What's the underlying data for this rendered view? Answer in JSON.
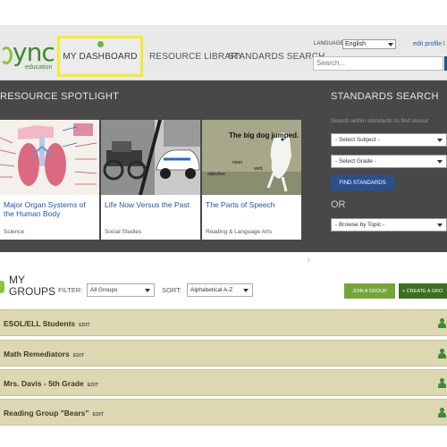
{
  "header": {
    "logo_text": "ync",
    "logo_sub": "education",
    "nav": {
      "dashboard": "MY DASHBOARD",
      "resource_library": "RESOURCE LIBRARY",
      "standards_search": "STANDARDS SEARCH"
    },
    "language_label": "LANGUAGE:",
    "language_value": "English",
    "edit_profile": "edit profile",
    "edit_profile_trail": "l",
    "search_placeholder": "Search..."
  },
  "spotlight": {
    "title": "RESOURCE SPOTLIGHT",
    "cards": [
      {
        "title": "Major Organ Systems of the Human Body",
        "category": "Science",
        "image": "anatomy-illustration"
      },
      {
        "title": "Life Now Versus the Past",
        "category": "Social Studies",
        "image": "old-car-vs-new-car-photo"
      },
      {
        "title": "The Parts of Speech",
        "category": "Reading & Language Arts",
        "image": "dog-jumping-photo",
        "image_caption": "The big dog jumped.",
        "image_words": [
          "adjective",
          "noun",
          "verb"
        ]
      }
    ]
  },
  "standards": {
    "title": "STANDARDS SEARCH",
    "hint": "Search within standards to find resour",
    "subject": "- Select Subject -",
    "grade": "- Select Grade -",
    "find_button": "FIND STANDARDS",
    "or": "OR",
    "topic": "- Browse by Topic -"
  },
  "groups": {
    "title_line1": "MY",
    "title_line2": "GROUPS",
    "filter_label": "FILTER:",
    "filter_value": "All Groups",
    "sort_label": "SORT:",
    "sort_value": "Alphabetical A-Z",
    "join_button": "JOIN A GROUP",
    "create_button": "+ CREATE A GRO",
    "edit_label": "EDIT",
    "items": [
      {
        "name": "ESOL/ELL Students"
      },
      {
        "name": "Math Remediators"
      },
      {
        "name": "Mrs. Davis - 5th Grade"
      },
      {
        "name": "Reading Group \"Bears\""
      }
    ]
  },
  "colors": {
    "accent_green": "#74a637",
    "dark_green": "#3c6f23",
    "link_blue": "#1f56a8",
    "highlight_yellow": "#f4ec2e",
    "spotlight_bg": "#484848",
    "group_row_bg": "#ddd7b2"
  }
}
